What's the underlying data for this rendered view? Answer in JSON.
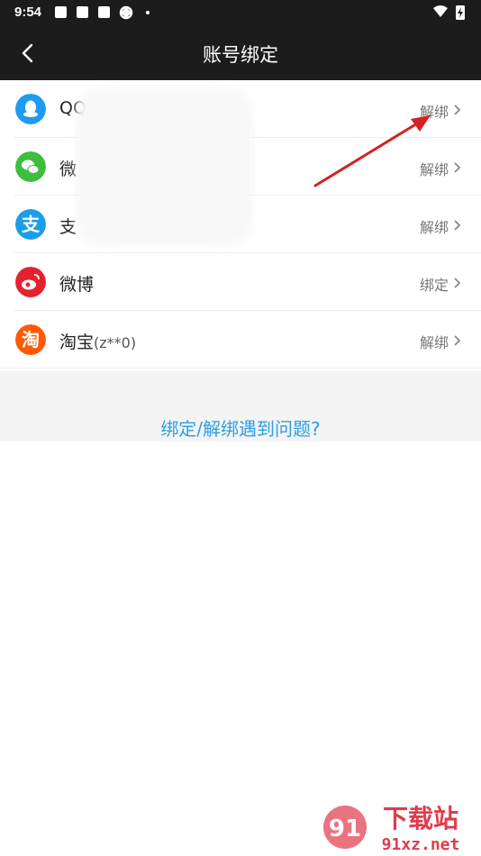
{
  "status_bar": {
    "time": "9:54"
  },
  "header": {
    "title": "账号绑定"
  },
  "accounts": [
    {
      "name": "QQ",
      "name_visible": "QQ",
      "sub": "",
      "action": "解绑",
      "color": "#1e9bf0"
    },
    {
      "name": "微信",
      "name_visible": "微",
      "sub": "",
      "action": "解绑",
      "color": "#3ebd3e"
    },
    {
      "name": "支付宝",
      "name_visible": "支",
      "sub": "",
      "action": "解绑",
      "color": "#1a9ee8"
    },
    {
      "name": "微博",
      "name_visible": "微博",
      "sub": "",
      "action": "绑定",
      "color": "#e6212f"
    },
    {
      "name": "淘宝",
      "name_visible": "淘宝",
      "sub": "(z**0)",
      "action": "解绑",
      "color": "#ff5a00"
    }
  ],
  "help_link": "绑定/解绑遇到问题?",
  "watermark": {
    "text": "下载站",
    "domain": "91xz.net"
  }
}
